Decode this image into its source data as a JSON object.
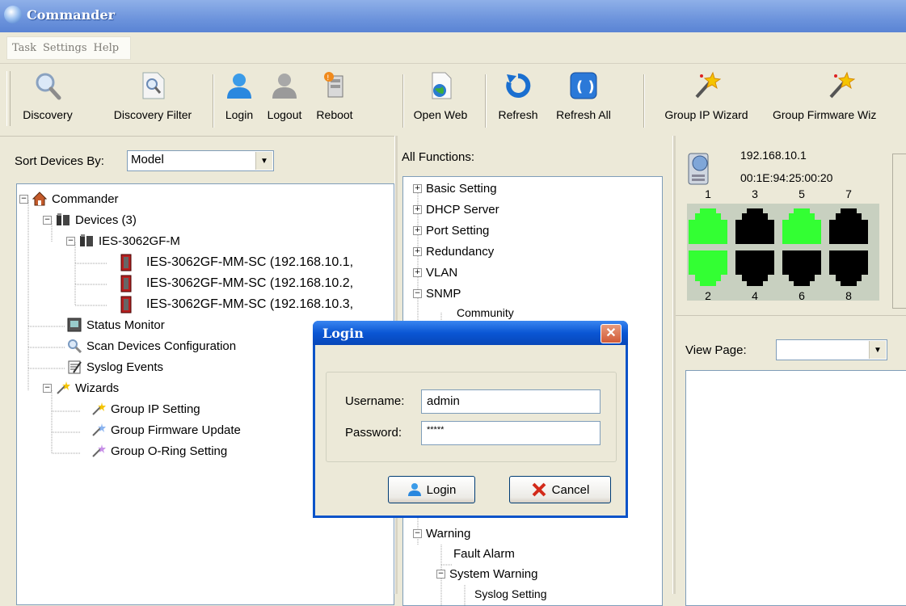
{
  "window": {
    "title": "Commander"
  },
  "menu": [
    "Task",
    "Settings",
    "Help"
  ],
  "toolbar": {
    "discovery": "Discovery",
    "discovery_filter": "Discovery Filter",
    "login": "Login",
    "logout": "Logout",
    "reboot": "Reboot",
    "open_web": "Open Web",
    "refresh": "Refresh",
    "refresh_all": "Refresh All",
    "group_ip_wizard": "Group IP Wizard",
    "group_firmware_wizard": "Group Firmware Wiz"
  },
  "left_panel": {
    "sort_label": "Sort Devices By:",
    "sort_value": "Model",
    "tree": {
      "root": "Commander",
      "devices": "Devices (3)",
      "model": "IES-3062GF-M",
      "device_items": [
        "IES-3062GF-MM-SC (192.168.10.1,",
        "IES-3062GF-MM-SC (192.168.10.2,",
        "IES-3062GF-MM-SC (192.168.10.3,"
      ],
      "status_monitor": "Status Monitor",
      "scan_devices": "Scan Devices Configuration",
      "syslog": "Syslog Events",
      "wizards": "Wizards",
      "wizard_items": [
        "Group IP Setting",
        "Group Firmware Update",
        "Group O-Ring Setting"
      ]
    }
  },
  "middle_panel": {
    "label": "All Functions:",
    "items": [
      "Basic Setting",
      "DHCP Server",
      "Port Setting",
      "Redundancy",
      "VLAN",
      "SNMP"
    ],
    "snmp_child": "Community",
    "warning": "Warning",
    "fault_alarm": "Fault Alarm",
    "system_warning": "System Warning",
    "syslog_setting": "Syslog Setting"
  },
  "right_panel": {
    "ip": "192.168.10.1",
    "mac": "00:1E:94:25:00:20",
    "ports_top": [
      "1",
      "3",
      "5",
      "7"
    ],
    "ports_bottom": [
      "2",
      "4",
      "6",
      "8"
    ],
    "port_status_top": [
      "up",
      "down",
      "up",
      "down"
    ],
    "port_status_bottom": [
      "up",
      "down",
      "down",
      "down"
    ],
    "colors": {
      "up": "#33ff33",
      "down": "#000000"
    },
    "view_page_label": "View Page:",
    "view_page_value": ""
  },
  "dialog": {
    "title": "Login",
    "close": "✕",
    "username_label": "Username:",
    "username_value": "admin",
    "password_label": "Password:",
    "password_value": "*****",
    "login_button": "Login",
    "cancel_button": "Cancel"
  }
}
